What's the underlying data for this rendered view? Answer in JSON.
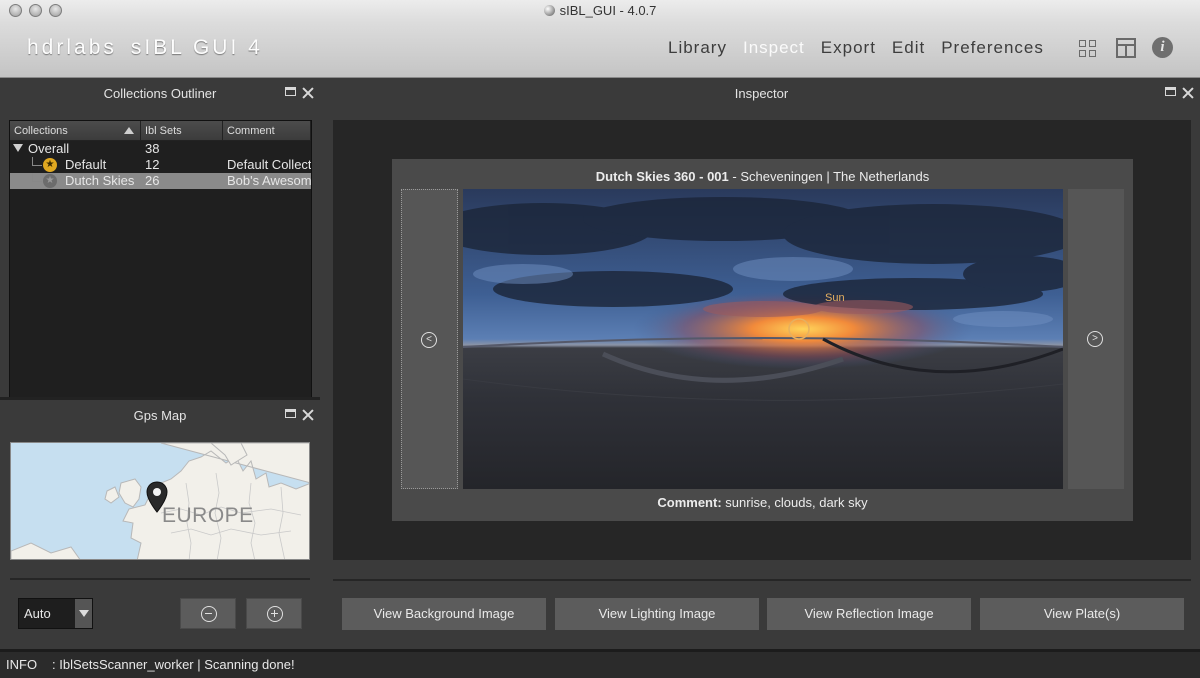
{
  "window": {
    "title": "sIBL_GUI - 4.0.7"
  },
  "toolbar": {
    "brand_left": "hdrlabs",
    "brand_right": "sIBL GUI 4",
    "menu": [
      {
        "label": "Library",
        "active": false
      },
      {
        "label": "Inspect",
        "active": true
      },
      {
        "label": "Export",
        "active": false
      },
      {
        "label": "Edit",
        "active": false
      },
      {
        "label": "Preferences",
        "active": false
      }
    ],
    "icons": [
      "grid-layout-icon",
      "layouts-icon",
      "info-icon"
    ],
    "info_glyph": "i"
  },
  "collections": {
    "title": "Collections Outliner",
    "columns": [
      "Collections",
      "Ibl Sets",
      "Comment"
    ],
    "rows": [
      {
        "name": "Overall",
        "count": "38",
        "comment": "",
        "selected": false
      },
      {
        "name": "Default",
        "count": "12",
        "comment": "Default Collection",
        "selected": false
      },
      {
        "name": "Dutch Skies",
        "count": "26",
        "comment": "Bob's Awesome Collection",
        "selected": true
      }
    ]
  },
  "gps": {
    "title": "Gps Map",
    "map_label": "EUROPE",
    "zoom_value": "Auto"
  },
  "inspector": {
    "title": "Inspector",
    "set_name": "Dutch Skies 360 - 001",
    "location": "Scheveningen | The Netherlands",
    "comment_label": "Comment:",
    "comment": "sunrise, clouds, dark sky",
    "sun_label": "Sun",
    "prev_glyph": "<",
    "next_glyph": ">",
    "buttons": [
      "View Background Image",
      "View Lighting Image",
      "View Reflection Image",
      "View Plate(s)"
    ]
  },
  "status": {
    "level": "INFO",
    "message": ": IblSetsScanner_worker | Scanning done!"
  },
  "colors": {
    "accent_star": "#e0a820",
    "selection": "#8a8a8a",
    "panel_bg": "#3a3a3a"
  }
}
